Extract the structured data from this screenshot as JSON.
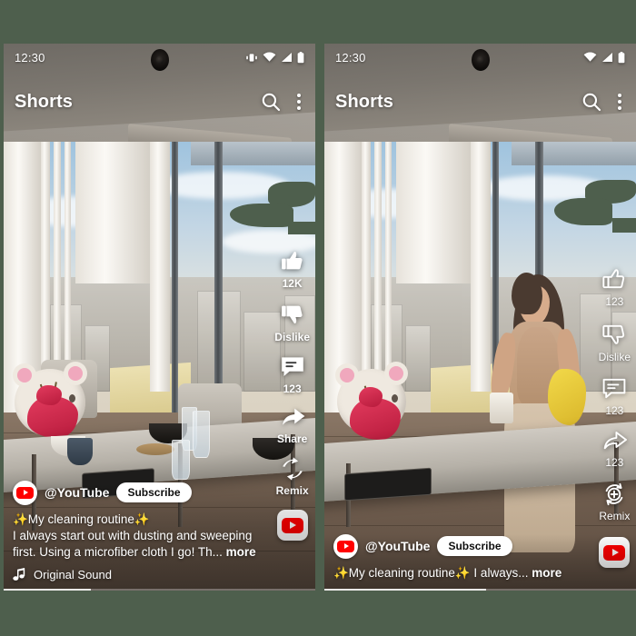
{
  "background_color": "#4e5f4d",
  "panels": [
    {
      "id": "left",
      "status_bar": {
        "time": "12:30",
        "icons": [
          "vibrate-icon",
          "wifi-icon",
          "signal-icon",
          "battery-icon"
        ]
      },
      "header": {
        "title": "Shorts",
        "search_icon": "search-icon",
        "menu_icon": "more-options-icon"
      },
      "rail": {
        "style": "filled",
        "items": [
          {
            "icon": "thumbs-up-icon",
            "label": "12K"
          },
          {
            "icon": "thumbs-down-icon",
            "label": "Dislike"
          },
          {
            "icon": "comment-icon",
            "label": "123"
          },
          {
            "icon": "share-icon",
            "label": "Share"
          },
          {
            "icon": "remix-icon",
            "label": "Remix"
          }
        ],
        "channel_chip_icon": "youtube-logo-icon"
      },
      "overlay": {
        "avatar_icon": "youtube-logo-icon",
        "channel_name": "@YouTube",
        "subscribe_label": "Subscribe",
        "caption_line1": "✨My cleaning routine✨",
        "caption_line2": "I always start out with dusting and sweeping",
        "caption_line3": "first. Using a microfiber cloth I go! Th...",
        "caption_more": "more",
        "sound_icon": "music-note-icon",
        "sound_name": "Original Sound"
      },
      "progress_percent": 28
    },
    {
      "id": "right",
      "status_bar": {
        "time": "12:30",
        "icons": [
          "wifi-icon",
          "signal-icon",
          "battery-icon"
        ]
      },
      "header": {
        "title": "Shorts",
        "search_icon": "search-icon",
        "menu_icon": "more-options-icon"
      },
      "rail": {
        "style": "outline",
        "items": [
          {
            "icon": "thumbs-up-icon",
            "label": "123"
          },
          {
            "icon": "thumbs-down-icon",
            "label": "Dislike"
          },
          {
            "icon": "comment-icon",
            "label": "123"
          },
          {
            "icon": "share-icon",
            "label": "123"
          },
          {
            "icon": "remix-icon",
            "label": "Remix"
          }
        ],
        "channel_chip_icon": "youtube-logo-icon"
      },
      "overlay": {
        "avatar_icon": "youtube-logo-icon",
        "channel_name": "@YouTube",
        "subscribe_label": "Subscribe",
        "caption_line1": "✨My cleaning routine✨  I always...",
        "caption_more": "more"
      },
      "progress_percent": 52
    }
  ]
}
